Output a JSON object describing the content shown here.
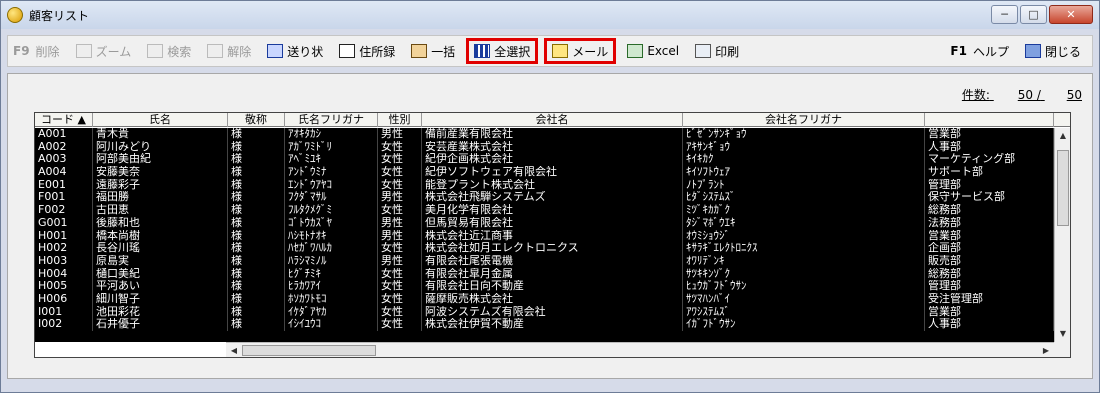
{
  "window": {
    "title": "顧客リスト",
    "min": "─",
    "max": "□",
    "close": "✕"
  },
  "toolbar": {
    "delete": {
      "key": "F9",
      "label": "削除"
    },
    "zoom": "ズーム",
    "search": "検索",
    "cancel": "解除",
    "invoice": "送り状",
    "address_book": "住所録",
    "batch": "一括",
    "select_all": "全選択",
    "mail": "メール",
    "excel": "Excel",
    "print": "印刷",
    "help": {
      "key": "F1",
      "label": "ヘルプ"
    },
    "close": "閉じる"
  },
  "count": {
    "label": "件数:",
    "value": "50 /",
    "total": "50"
  },
  "table": {
    "headers": [
      "コード ▲",
      "氏名",
      "敬称",
      "氏名フリガナ",
      "性別",
      "会社名",
      "会社名フリガナ",
      ""
    ],
    "rows": [
      [
        "A001",
        "青木貴",
        "様",
        "ｱｵｷﾀｶｼ",
        "男性",
        "備前産業有限会社",
        "ﾋﾞｾﾞﾝｻﾝｷﾞｮｳ",
        "営業部"
      ],
      [
        "A002",
        "阿川みどり",
        "様",
        "ｱｶﾞﾜﾐﾄﾞﾘ",
        "女性",
        "安芸産業株式会社",
        "ｱｷｻﾝｷﾞｮｳ",
        "人事部"
      ],
      [
        "A003",
        "阿部美由紀",
        "様",
        "ｱﾍﾞﾐﾕｷ",
        "女性",
        "紀伊企画株式会社",
        "ｷｲｷｶｸ",
        "マーケティング部"
      ],
      [
        "A004",
        "安藤美奈",
        "様",
        "ｱﾝﾄﾞｳﾐﾅ",
        "女性",
        "紀伊ソフトウェア有限会社",
        "ｷｲｿﾌﾄｳｪｱ",
        "サポート部"
      ],
      [
        "E001",
        "遠藤彩子",
        "様",
        "ｴﾝﾄﾞｳｱﾔｺ",
        "女性",
        "能登プラント株式会社",
        "ﾉﾄﾌﾟﾗﾝﾄ",
        "管理部"
      ],
      [
        "F001",
        "福田勝",
        "様",
        "ﾌｸﾀﾞﾏｻﾙ",
        "男性",
        "株式会社飛騨システムズ",
        "ﾋﾀﾞｼｽﾃﾑｽﾞ",
        "保守サービス部"
      ],
      [
        "F002",
        "古田恵",
        "様",
        "ﾌﾙﾀｸﾒｸﾞﾐ",
        "女性",
        "美月化学有限会社",
        "ﾐﾂﾞｷｶｶﾞｸ",
        "総務部"
      ],
      [
        "G001",
        "後藤和也",
        "様",
        "ｺﾞﾄｳｶｽﾞﾔ",
        "男性",
        "但馬貿易有限会社",
        "ﾀｼﾞﾏﾎﾞｳｴｷ",
        "法務部"
      ],
      [
        "H001",
        "橋本尚樹",
        "様",
        "ﾊｼﾓﾄﾅｵｷ",
        "男性",
        "株式会社近江商事",
        "ｵｳﾐｼｮｳｼﾞ",
        "営業部"
      ],
      [
        "H002",
        "長谷川瑤",
        "様",
        "ﾊｾｶﾞﾜﾊﾙｶ",
        "女性",
        "株式会社如月エレクトロニクス",
        "ｷｻﾗｷﾞｴﾚｸﾄﾛﾆｸｽ",
        "企画部"
      ],
      [
        "H003",
        "原島実",
        "様",
        "ﾊﾗｼﾏﾐﾉﾙ",
        "男性",
        "有限会社尾張電機",
        "ｵﾜﾘﾃﾞﾝｷ",
        "販売部"
      ],
      [
        "H004",
        "樋口美紀",
        "様",
        "ﾋｸﾞﾁﾐｷ",
        "女性",
        "有限会社皐月金属",
        "ｻﾂｷｷﾝｿﾞｸ",
        "総務部"
      ],
      [
        "H005",
        "平河あい",
        "様",
        "ﾋﾗｶﾜｱｲ",
        "女性",
        "有限会社日向不動産",
        "ﾋｭｳｶﾞﾌﾄﾞｳｻﾝ",
        "管理部"
      ],
      [
        "H006",
        "細川智子",
        "様",
        "ﾎｿｶﾜﾄﾓｺ",
        "女性",
        "薩摩販売株式会社",
        "ｻﾂﾏﾊﾝﾊﾞｲ",
        "受注管理部"
      ],
      [
        "I001",
        "池田彩花",
        "様",
        "ｲｹﾀﾞｱﾔｶ",
        "女性",
        "阿波システムズ有限会社",
        "ｱﾜｼｽﾃﾑｽﾞ",
        "営業部"
      ],
      [
        "I002",
        "石井優子",
        "様",
        "ｲｼｲﾕｳｺ",
        "女性",
        "株式会社伊賀不動産",
        "ｲｶﾞﾌﾄﾞｳｻﾝ",
        "人事部"
      ]
    ]
  }
}
